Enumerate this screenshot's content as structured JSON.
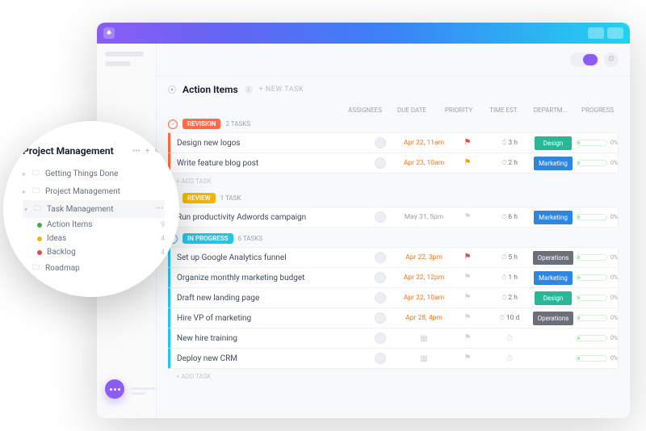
{
  "colors": {
    "revision": "#ff6b4a",
    "review": "#f2b705",
    "inprogress": "#29c3e6",
    "design": "#2ab796",
    "marketing": "#2f86e0",
    "operations": "#6b6f7a",
    "green": "#3bb34a",
    "yellow": "#f2b705",
    "red": "#ef4444"
  },
  "header": {
    "title": "Action Items",
    "new_task": "+ NEW TASK"
  },
  "columns": {
    "assignees": "ASSIGNEES",
    "due": "DUE DATE",
    "priority": "PRIORITY",
    "est": "TIME EST.",
    "dept": "DEPARTM...",
    "progress": "PROGRESS"
  },
  "groups": [
    {
      "status": "REVISION",
      "color": "#ff6b4a",
      "count_label": "2 TASKS",
      "tasks": [
        {
          "title": "Design new logos",
          "due": "Apr 22, 11am",
          "due_color": "orange",
          "flag": "red",
          "est": "3 h",
          "dept": "Design",
          "dept_color": "#2ab796",
          "progress": "0%"
        },
        {
          "title": "Write feature blog post",
          "due": "Apr 23, 10am",
          "due_color": "orange",
          "flag": "orange",
          "est": "2 h",
          "dept": "Marketing",
          "dept_color": "#2f86e0",
          "progress": "0%"
        }
      ],
      "add": "+ ADD TASK"
    },
    {
      "status": "REVIEW",
      "color": "#f2b705",
      "count_label": "1 TASK",
      "tasks": [
        {
          "title": "Run productivity Adwords campaign",
          "due": "May 31, 5pm",
          "due_color": "gray",
          "flag": "gray",
          "est": "6 h",
          "dept": "Marketing",
          "dept_color": "#2f86e0",
          "progress": "0%"
        }
      ]
    },
    {
      "status": "IN PROGRESS",
      "color": "#29c3e6",
      "count_label": "6 TASKS",
      "tasks": [
        {
          "title": "Set up Google Analytics funnel",
          "due": "Apr 22, 3pm",
          "due_color": "orange",
          "flag": "red",
          "est": "5 h",
          "dept": "Operations",
          "dept_color": "#6b6f7a",
          "progress": "0%"
        },
        {
          "title": "Organize monthly marketing budget",
          "due": "Apr 22, 12pm",
          "due_color": "orange",
          "flag": "gray",
          "est": "1 h",
          "dept": "Marketing",
          "dept_color": "#2f86e0",
          "progress": "0%"
        },
        {
          "title": "Draft new landing page",
          "due": "Apr 22, 10am",
          "due_color": "orange",
          "flag": "gray",
          "est": "2 h",
          "dept": "Design",
          "dept_color": "#2ab796",
          "progress": "0%"
        },
        {
          "title": "Hire VP of marketing",
          "due": "Apr 28, 4pm",
          "due_color": "orange",
          "flag": "gray",
          "est": "10 d",
          "dept": "Operations",
          "dept_color": "#6b6f7a",
          "progress": "0%"
        },
        {
          "title": "New hire training",
          "due": "cal",
          "due_color": "gray",
          "flag": "gray",
          "est": "none",
          "dept": "",
          "dept_color": "",
          "progress": "0%"
        },
        {
          "title": "Deploy new CRM",
          "due": "cal",
          "due_color": "gray",
          "flag": "gray",
          "est": "none",
          "dept": "",
          "dept_color": "",
          "progress": "0%"
        }
      ],
      "add": "+ ADD TASK"
    }
  ],
  "lens": {
    "title": "Project Management",
    "folders": [
      {
        "label": "Getting Things Done"
      },
      {
        "label": "Project Management"
      }
    ],
    "selected": {
      "label": "Task Management"
    },
    "lists": [
      {
        "label": "Action Items",
        "color": "#3bb34a",
        "count": "9"
      },
      {
        "label": "Ideas",
        "color": "#f2b705",
        "count": "4"
      },
      {
        "label": "Backlog",
        "color": "#ef4444",
        "count": "4"
      }
    ],
    "roadmap": {
      "label": "Roadmap"
    }
  }
}
